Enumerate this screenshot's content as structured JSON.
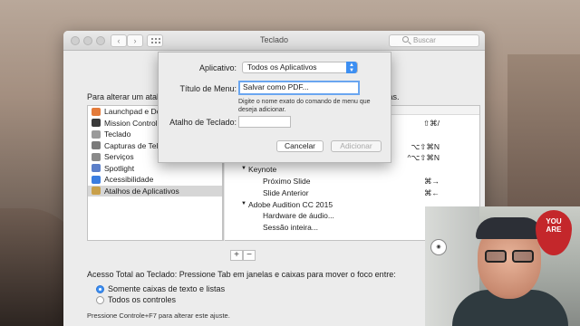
{
  "window": {
    "title": "Teclado",
    "search_placeholder": "Buscar",
    "nav_back": "‹",
    "nav_forward": "›"
  },
  "prefs": {
    "intro_left": "Para alterar um atalh",
    "intro_right": "clas.",
    "list_items": [
      {
        "label": "Launchpad e Dock",
        "color": "#e47b3a"
      },
      {
        "label": "Mission Control",
        "color": "#3a3a3a"
      },
      {
        "label": "Teclado",
        "color": "#9a9a9a"
      },
      {
        "label": "Capturas de Tela",
        "color": "#7a7a7a"
      },
      {
        "label": "Serviços",
        "color": "#8a8a8a"
      },
      {
        "label": "Spotlight",
        "color": "#5b7fc9"
      },
      {
        "label": "Acessibilidade",
        "color": "#3a7de0"
      },
      {
        "label": "Atalhos de Aplicativos",
        "color": "#c9a04a"
      }
    ],
    "shortcut_rows": [
      {
        "label": "",
        "key": "⇧⌘/",
        "indent": 0,
        "disclosure": false
      },
      {
        "label": "",
        "key": "",
        "indent": 0,
        "disclosure": false
      },
      {
        "label": "",
        "key": "⌥⇧⌘N",
        "indent": 0,
        "disclosure": false
      },
      {
        "label": "",
        "key": "^⌥⇧⌘N",
        "indent": 0,
        "disclosure": false
      },
      {
        "label": "Keynote",
        "key": "",
        "indent": 0,
        "disclosure": true
      },
      {
        "label": "Próximo Slide",
        "key": "⌘→",
        "indent": 1,
        "disclosure": false
      },
      {
        "label": "Slide Anterior",
        "key": "⌘←",
        "indent": 1,
        "disclosure": false
      },
      {
        "label": "Adobe Audition CC 2015",
        "key": "",
        "indent": 0,
        "disclosure": true
      },
      {
        "label": "Hardware de áudio...",
        "key": "",
        "indent": 1,
        "disclosure": false
      },
      {
        "label": "Sessão inteira...",
        "key": "",
        "indent": 1,
        "disclosure": false
      }
    ],
    "plus": "+",
    "minus": "−",
    "full_access_label": "Acesso Total ao Teclado: Pressione Tab em janelas e caixas para mover o foco entre:",
    "radio_options": [
      {
        "label": "Somente caixas de texto e listas",
        "selected": true
      },
      {
        "label": "Todos os controles",
        "selected": false
      }
    ],
    "hint": "Pressione Controle+F7 para alterar este ajuste."
  },
  "sheet": {
    "app_label": "Aplicativo:",
    "app_value": "Todos os Aplicativos",
    "menu_title_label": "Título de Menu:",
    "menu_title_value": "Salvar como PDF...",
    "help_text": "Digite o nome exato do comando de menu que deseja adicionar.",
    "shortcut_label": "Atalho de Teclado:",
    "shortcut_value": "",
    "cancel_label": "Cancelar",
    "add_label": "Adicionar"
  },
  "webcam": {
    "badge_text": "YOU ARE"
  }
}
